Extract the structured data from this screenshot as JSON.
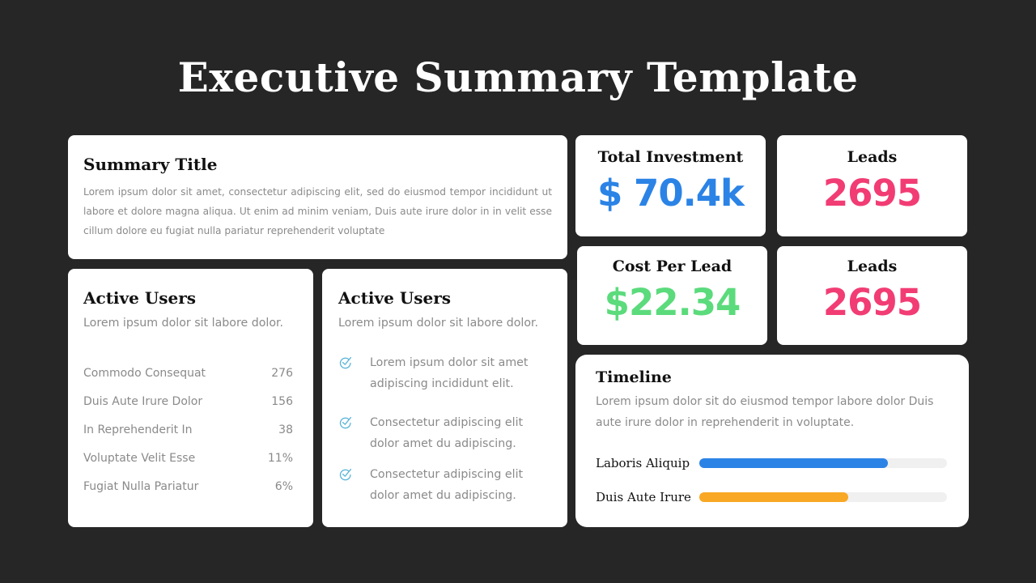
{
  "page": {
    "title": "Executive Summary Template"
  },
  "colors": {
    "background": "#262626",
    "card": "#ffffff",
    "blue": "#2b83e6",
    "pink": "#f23c74",
    "green": "#5bdb7c",
    "orange": "#f9a825",
    "check": "#5ab4d8",
    "muted_text": "#8a8a8a",
    "track": "#f0f0f0"
  },
  "summary": {
    "title": "Summary Title",
    "body": "Lorem ipsum dolor sit amet, consectetur adipiscing elit, sed do eiusmod tempor incididunt ut labore et dolore magna aliqua. Ut enim ad minim veniam, Duis aute irure dolor in in velit esse cillum dolore eu fugiat nulla pariatur reprehenderit voluptate"
  },
  "active_users_table": {
    "title": "Active Users",
    "subtitle": "Lorem ipsum dolor sit labore dolor.",
    "rows": [
      {
        "label": "Commodo Consequat",
        "value": "276"
      },
      {
        "label": "Duis Aute Irure Dolor",
        "value": "156"
      },
      {
        "label": "In Reprehenderit In",
        "value": "38"
      },
      {
        "label": "Voluptate Velit Esse",
        "value": "11%"
      },
      {
        "label": "Fugiat Nulla Pariatur",
        "value": "6%"
      }
    ]
  },
  "active_users_checks": {
    "title": "Active Users",
    "subtitle": "Lorem ipsum dolor sit labore dolor.",
    "items": [
      {
        "icon": "check-circle-icon",
        "text": "Lorem ipsum dolor sit amet adipiscing incididunt elit."
      },
      {
        "icon": "check-circle-icon",
        "text": "Consectetur adipiscing elit dolor amet du adipiscing."
      },
      {
        "icon": "check-circle-icon",
        "text": "Consectetur adipiscing elit dolor amet du adipiscing."
      }
    ]
  },
  "stats": {
    "total_investment": {
      "label": "Total Investment",
      "value": "$ 70.4k"
    },
    "leads_1": {
      "label": "Leads",
      "value": "2695"
    },
    "cost_per_lead": {
      "label": "Cost Per Lead",
      "value": "$22.34"
    },
    "leads_2": {
      "label": "Leads",
      "value": "2695"
    }
  },
  "timeline": {
    "title": "Timeline",
    "body": "Lorem ipsum dolor sit do eiusmod tempor labore dolor Duis aute irure dolor in reprehenderit in voluptate.",
    "bars": [
      {
        "label": "Laboris Aliquip",
        "percent": 76,
        "color": "#2b83e6"
      },
      {
        "label": "Duis Aute Irure",
        "percent": 60,
        "color": "#f9a825"
      }
    ]
  }
}
